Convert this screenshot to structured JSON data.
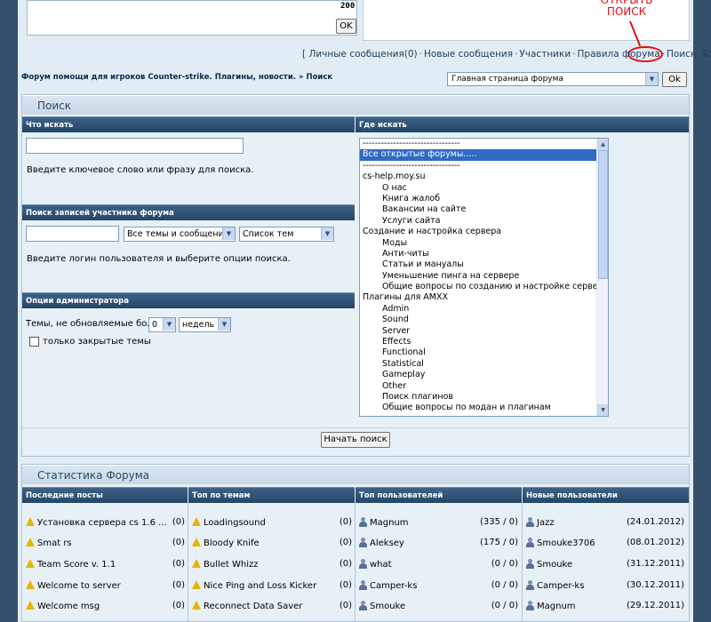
{
  "top": {
    "chat_count": "200",
    "chat_ok": "OK",
    "annotation": "ОТКРЫТЬ ПОИСК"
  },
  "nav": {
    "links": [
      "Личные сообщения(0)",
      "Новые сообщения",
      "Участники",
      "Правила форума",
      "Поиск",
      "RSS"
    ]
  },
  "breadcrumb": {
    "forum": "Форум помощи для игроков Counter-strike. Плагины, новости.",
    "sep": "»",
    "current": "Поиск"
  },
  "jump": {
    "selected": "Главная страница форума",
    "ok": "Ok"
  },
  "search": {
    "title": "Поиск",
    "what_head": "Что искать",
    "where_head": "Где искать",
    "keyword_hint": "Введите ключевое слово или фразу для поиска.",
    "member_head": "Поиск записей участника форума",
    "member_scope": "Все темы и сообщения",
    "member_view": "Список тем",
    "member_hint": "Введите логин пользователя и выберите опции поиска.",
    "admin_head": "Опции администратора",
    "admin_label": "Темы, не обновляемые более",
    "admin_num": "0",
    "admin_unit": "недель",
    "closed_only": "только закрытые темы",
    "button": "Начать поиск",
    "forums": [
      {
        "t": "--------------------------------",
        "sub": false,
        "sel": false
      },
      {
        "t": "Все открытые форумы.....",
        "sub": false,
        "sel": true
      },
      {
        "t": "--------------------------------",
        "sub": false,
        "sel": false
      },
      {
        "t": "cs-help.moy.su",
        "sub": false,
        "sel": false
      },
      {
        "t": "О нас",
        "sub": true,
        "sel": false
      },
      {
        "t": "Книга жалоб",
        "sub": true,
        "sel": false
      },
      {
        "t": "Вакансии на сайте",
        "sub": true,
        "sel": false
      },
      {
        "t": "Услуги сайта",
        "sub": true,
        "sel": false
      },
      {
        "t": "Создание и настройка сервера",
        "sub": false,
        "sel": false
      },
      {
        "t": "Моды",
        "sub": true,
        "sel": false
      },
      {
        "t": "Анти-читы",
        "sub": true,
        "sel": false
      },
      {
        "t": "Статьи и мануалы",
        "sub": true,
        "sel": false
      },
      {
        "t": "Уменьшение пинга на сервере",
        "sub": true,
        "sel": false
      },
      {
        "t": "Общие вопросы по созданию и настройке серверов",
        "sub": true,
        "sel": false
      },
      {
        "t": "Плагины для AMXX",
        "sub": false,
        "sel": false
      },
      {
        "t": "Admin",
        "sub": true,
        "sel": false
      },
      {
        "t": "Sound",
        "sub": true,
        "sel": false
      },
      {
        "t": "Server",
        "sub": true,
        "sel": false
      },
      {
        "t": "Effects",
        "sub": true,
        "sel": false
      },
      {
        "t": "Functional",
        "sub": true,
        "sel": false
      },
      {
        "t": "Statistical",
        "sub": true,
        "sel": false
      },
      {
        "t": "Gameplay",
        "sub": true,
        "sel": false
      },
      {
        "t": "Other",
        "sub": true,
        "sel": false
      },
      {
        "t": "Поиск плагинов",
        "sub": true,
        "sel": false
      },
      {
        "t": "Общие вопросы по модан и плагинам",
        "sub": true,
        "sel": false
      }
    ]
  },
  "stats": {
    "title": "Статистика Форума",
    "heads": [
      "Последние посты",
      "Топ по темам",
      "Топ пользователей",
      "Новые пользователи"
    ],
    "recent": [
      {
        "t": "Установка сервера cs 1.6 ...",
        "c": "(0)"
      },
      {
        "t": "Smat rs",
        "c": "(0)"
      },
      {
        "t": "Team Score v. 1.1",
        "c": "(0)"
      },
      {
        "t": "Welcome to server",
        "c": "(0)"
      },
      {
        "t": "Welcome msg",
        "c": "(0)"
      }
    ],
    "top_topics": [
      {
        "t": "Loadingsound",
        "c": "(0)"
      },
      {
        "t": "Bloody Knife",
        "c": "(0)"
      },
      {
        "t": "Bullet Whizz",
        "c": "(0)"
      },
      {
        "t": "Nice Ping and Loss Kicker",
        "c": "(0)"
      },
      {
        "t": "Reconnect Data Saver",
        "c": "(0)"
      }
    ],
    "top_users": [
      {
        "t": "Magnum",
        "c": "(335 / 0)"
      },
      {
        "t": "Aleksey",
        "c": "(175 / 0)"
      },
      {
        "t": "what",
        "c": "(0 / 0)"
      },
      {
        "t": "Camper-ks",
        "c": "(0 / 0)"
      },
      {
        "t": "Smouke",
        "c": "(0 / 0)"
      }
    ],
    "new_users": [
      {
        "t": "Jazz",
        "c": "(24.01.2012)"
      },
      {
        "t": "Smouke3706",
        "c": "(08.01.2012)"
      },
      {
        "t": "Smouke",
        "c": "(31.12.2011)"
      },
      {
        "t": "Camper-ks",
        "c": "(30.12.2011)"
      },
      {
        "t": "Magnum",
        "c": "(29.12.2011)"
      }
    ]
  }
}
